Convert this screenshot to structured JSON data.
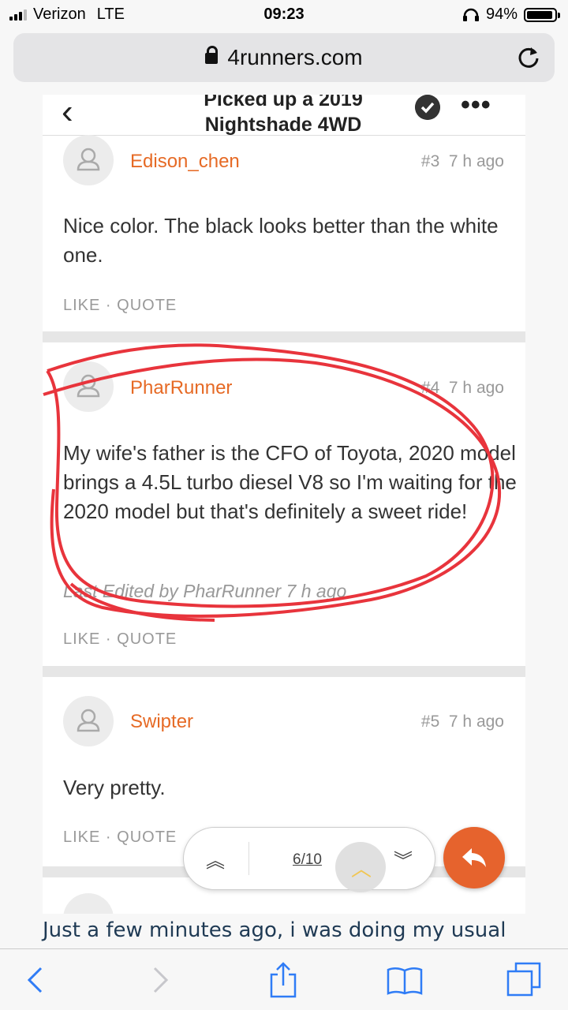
{
  "status_bar": {
    "carrier": "Verizon",
    "network": "LTE",
    "time": "09:23",
    "battery": "94%",
    "battery_level": 0.94
  },
  "browser": {
    "url": "4runners.com"
  },
  "thread": {
    "title_line1": "Picked up a 2019",
    "title_line2": "Nightshade 4WD"
  },
  "posts": [
    {
      "author": "Edison_chen",
      "number": "#3",
      "time": "7 h ago",
      "body": "Nice color. The black looks better than the white one.",
      "like": "LIKE",
      "quote": "QUOTE"
    },
    {
      "author": "PharRunner",
      "number": "#4",
      "time": "7 h ago",
      "body": "My wife's father is the CFO of Toyota, 2020 model brings a 4.5L turbo diesel V8 so I'm waiting for the 2020 model but that's definitely a sweet ride!",
      "edited": "Last Edited by PharRunner 7 h ago",
      "like": "LIKE",
      "quote": "QUOTE"
    },
    {
      "author": "Swipter",
      "number": "#5",
      "time": "7 h ago",
      "body": "Very pretty.",
      "like": "LIKE",
      "quote": "QUOTE"
    }
  ],
  "pager": {
    "count": "6/10"
  },
  "caption": "Just a few minutes ago, i was doing my usual",
  "colors": {
    "accent": "#e66a25",
    "annotation": "#e8343c"
  },
  "icons": [
    "signal-icon",
    "headphones-icon",
    "battery-icon",
    "lock-icon",
    "reload-icon",
    "back-icon",
    "check-icon",
    "more-icon",
    "user-icon",
    "first-page-icon",
    "scroll-up-icon",
    "last-page-icon",
    "reply-icon",
    "browser-back-icon",
    "browser-forward-icon",
    "share-icon",
    "bookmarks-icon",
    "tabs-icon"
  ]
}
